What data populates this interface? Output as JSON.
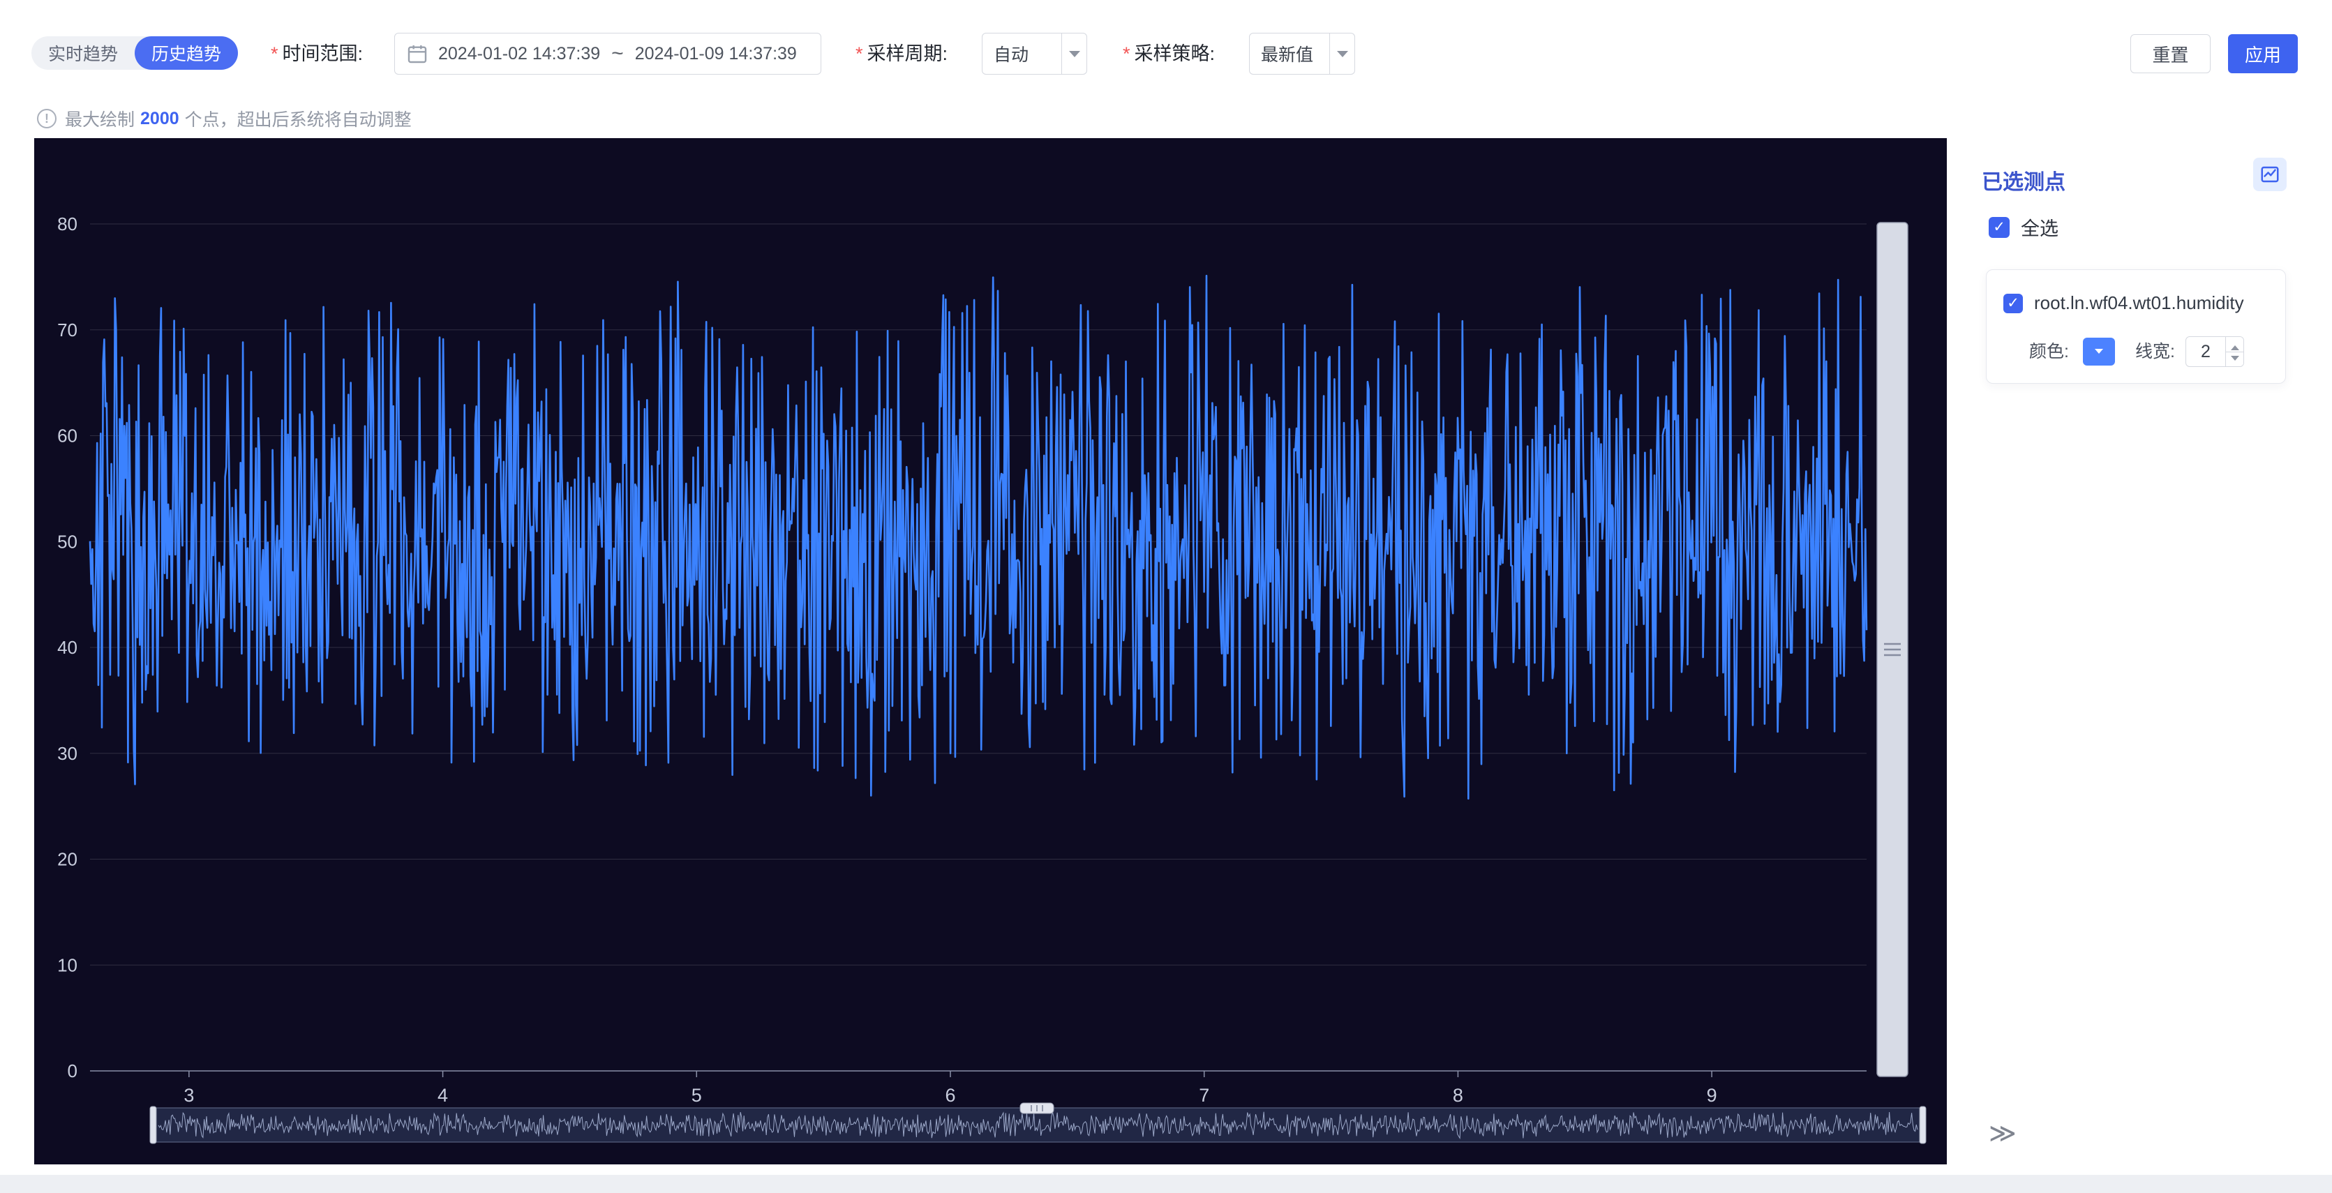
{
  "toolbar": {
    "required_mark": "*",
    "mode_tabs": [
      {
        "label": "实时趋势",
        "active": false
      },
      {
        "label": "历史趋势",
        "active": true
      }
    ],
    "time_range": {
      "label": "时间范围:",
      "start": "2024-01-02 14:37:39",
      "separator": "~",
      "end": "2024-01-09 14:37:39"
    },
    "sample_period": {
      "label": "采样周期:",
      "value": "自动"
    },
    "sample_strategy": {
      "label": "采样策略:",
      "value": "最新值"
    },
    "reset_label": "重置",
    "apply_label": "应用"
  },
  "notice": {
    "prefix": "最大绘制",
    "highlight": "2000",
    "suffix": "个点，超出后系统将自动调整"
  },
  "side_panel": {
    "title": "已选测点",
    "select_all_label": "全选",
    "points": [
      {
        "name": "root.ln.wf04.wt01.humidity",
        "checked": true,
        "color_label": "颜色:",
        "color": "#4c82ff",
        "width_label": "线宽:",
        "line_width": "2"
      }
    ],
    "collapse_icon": "≫"
  },
  "colors": {
    "primary": "#3e63f0",
    "chart_line": "#3b82ff",
    "chart_bg": "#0d0b22"
  },
  "chart_data": {
    "type": "line",
    "title": "",
    "xlabel": "",
    "ylabel": "",
    "x_ticks": [
      3,
      4,
      5,
      6,
      7,
      8,
      9
    ],
    "x_range": [
      2.61,
      9.61
    ],
    "y_ticks": [
      0,
      10,
      20,
      30,
      40,
      50,
      60,
      70,
      80
    ],
    "ylim": [
      0,
      80
    ],
    "grid": true,
    "legend": "none",
    "background": "#0d0b22",
    "axis_label_color": "#c9cede",
    "series": [
      {
        "name": "root.ln.wf04.wt01.humidity",
        "color": "#3b82ff",
        "stroke_width": 2.6,
        "signal": "dense pseudo-random humidity oscillation",
        "value_min": 25,
        "value_max": 76,
        "point_count": 1500,
        "seed": 20240102
      }
    ],
    "datazoom": {
      "horizontal": true,
      "vertical": true
    }
  }
}
